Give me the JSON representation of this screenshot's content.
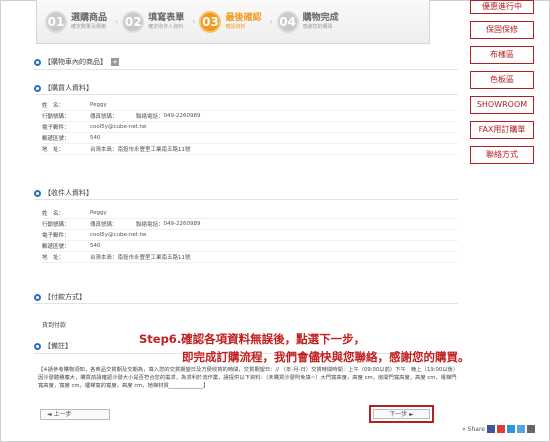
{
  "steps": [
    {
      "num": "01",
      "title": "選購商品",
      "sub": "確定數量及價格"
    },
    {
      "num": "02",
      "title": "填寫表單",
      "sub": "確定收件人資料"
    },
    {
      "num": "03",
      "title": "最後確認",
      "sub": "確認資料"
    },
    {
      "num": "04",
      "title": "購物完成",
      "sub": "感謝您的購買"
    }
  ],
  "side_menu": [
    "優惠進行中",
    "保固保修",
    "布樣區",
    "色板區",
    "SHOWROOM",
    "FAX用訂購單",
    "聯絡方式"
  ],
  "cart_section": {
    "title": "【購物車內的商品】",
    "toggle": "+"
  },
  "buyer": {
    "title": "【購買人資料】",
    "name_label": "姓　名：",
    "name": "Peggy",
    "mobile_label": "行動號碼：",
    "fax_label": "傳真號碼：",
    "phone_label": "聯絡電話：",
    "phone": "049-2260989",
    "email_label": "電子郵件：",
    "email": "cool5y@cube-net.tw",
    "zip_label": "郵遞區號：",
    "zip": "540",
    "addr_label": "地　址：",
    "addr": "台灣本島：南投市永豐里工業南五路11號"
  },
  "receiver": {
    "title": "【收件人資料】",
    "name_label": "姓　名：",
    "name": "Peggy",
    "mobile_label": "行動號碼：",
    "fax_label": "傳真號碼：",
    "phone_label": "聯絡電話：",
    "phone": "049-2260989",
    "email_label": "電子郵件：",
    "email": "cool5y@cube-net.tw",
    "zip_label": "郵遞區號：",
    "zip": "540",
    "addr_label": "地　址：",
    "addr": "台灣本島：南投市永豐里工業南五路11號"
  },
  "payment": {
    "title": "【付款方式】",
    "value": "貨到付款"
  },
  "remark": {
    "title": "【備註】",
    "text": "【※請參考購物須知，各商品交貨期及交期為，填入您的交貨期望日及方便收貨的時間，交貨期望日：// （年-月-日）交貨時間時間：上午（09:00以前）下午　晚上（19:00以後）因沙發體積龐大，購買前請確認沙發大小是否符合您的需求，為求利於流作業，請提供以下資料：（未購買沙發則免填~）大門寬高度，高度 cm，房間門寬高度，高度 cm，電梯門寬高度，寬度 cm，樓梯寬的寬度，高度 cm，她梯材質_____________】"
  },
  "overlay": {
    "line1": "Step6.確認各項資料無誤後，點選下一步，",
    "line2": "即完成訂購流程，我們會儘快與您聯絡，感謝您的購買。"
  },
  "nav": {
    "prev": "◄ 上一步",
    "next": "下一步 ►"
  },
  "share": {
    "label": "Share"
  },
  "colors": {
    "accent": "#f39a1e",
    "brand_red": "#b21f24",
    "overlay_red": "#c11f1f",
    "section_blue": "#2d6fb7"
  }
}
